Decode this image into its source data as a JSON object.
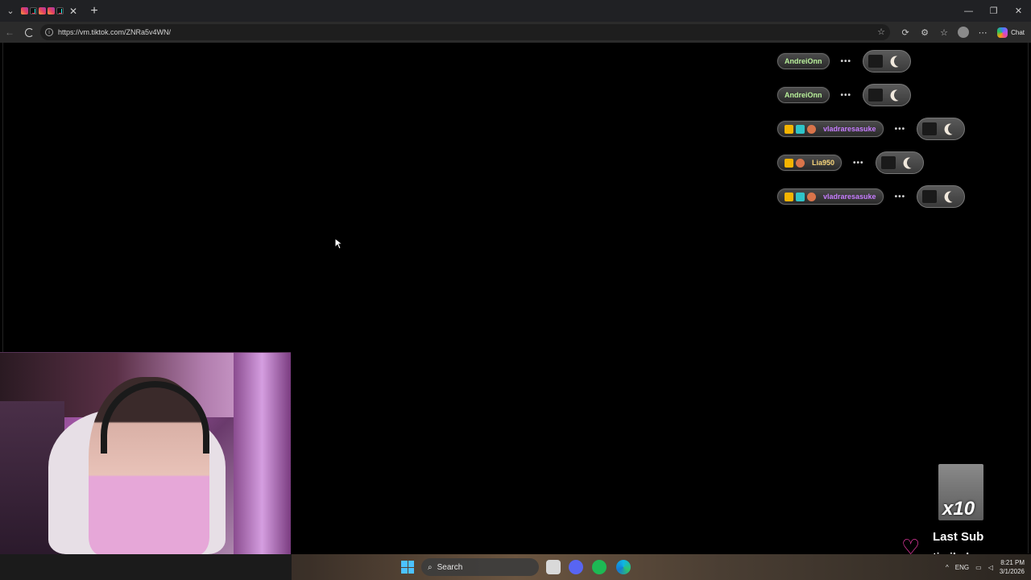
{
  "browser": {
    "tab_close": "✕",
    "tab_new": "+",
    "url": "https://vm.tiktok.com/ZNRa5v4WN/",
    "chat_label": "Chat",
    "window": {
      "minimize": "—",
      "restore": "❐",
      "close": "✕"
    }
  },
  "overlay": {
    "alerts": [
      {
        "name": "AndreiOnn",
        "name_color": "#b8f09a",
        "badges": []
      },
      {
        "name": "AndreiOnn",
        "name_color": "#b8f09a",
        "badges": []
      },
      {
        "name": "vladraresasuke",
        "name_color": "#c77dff",
        "badges": [
          "crown",
          "cube",
          "face"
        ]
      },
      {
        "name": "Lia950",
        "name_color": "#f6d47a",
        "badges": [
          "crown",
          "face"
        ]
      },
      {
        "name": "vladraresasuke",
        "name_color": "#c77dff",
        "badges": [
          "crown",
          "cube",
          "face"
        ]
      }
    ],
    "dots": "•••",
    "last_sub": {
      "gif_text": "x10",
      "label": "Last Sub",
      "name": "timihxh"
    }
  },
  "taskbar": {
    "search_label": "Search",
    "language": "ENG",
    "time": "8:21 PM",
    "date": "3/1/2026"
  },
  "colors": {
    "heart": "#ff3fb3",
    "windows_accent": "#4cc2ff"
  }
}
